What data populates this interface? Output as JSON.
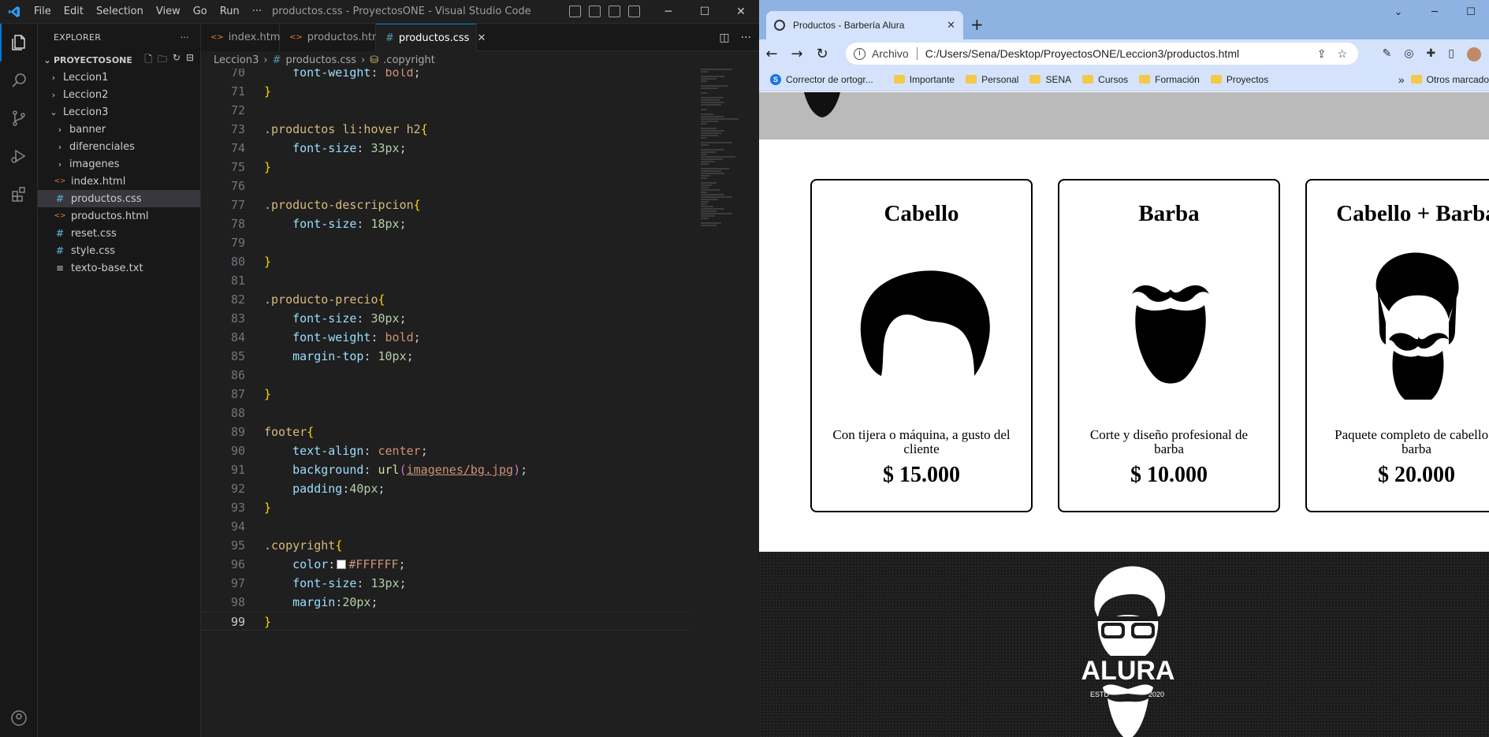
{
  "vscode": {
    "title": "productos.css - ProyectosONE - Visual Studio Code",
    "menu": [
      "File",
      "Edit",
      "Selection",
      "View",
      "Go",
      "Run",
      "···"
    ],
    "explorer": {
      "header": "EXPLORER",
      "root": "PROYECTOSONE",
      "items": [
        {
          "label": "Leccion1",
          "type": "folder",
          "expanded": false,
          "depth": 0
        },
        {
          "label": "Leccion2",
          "type": "folder",
          "expanded": false,
          "depth": 0
        },
        {
          "label": "Leccion3",
          "type": "folder",
          "expanded": true,
          "depth": 0
        },
        {
          "label": "banner",
          "type": "folder",
          "expanded": false,
          "depth": 1
        },
        {
          "label": "diferenciales",
          "type": "folder",
          "expanded": false,
          "depth": 1
        },
        {
          "label": "imagenes",
          "type": "folder",
          "expanded": false,
          "depth": 1
        },
        {
          "label": "index.html",
          "type": "html",
          "depth": 1
        },
        {
          "label": "productos.css",
          "type": "css",
          "depth": 1,
          "selected": true
        },
        {
          "label": "productos.html",
          "type": "html",
          "depth": 1
        },
        {
          "label": "reset.css",
          "type": "css",
          "depth": 1
        },
        {
          "label": "style.css",
          "type": "css",
          "depth": 1
        },
        {
          "label": "texto-base.txt",
          "type": "txt",
          "depth": 1
        }
      ]
    },
    "tabs": [
      {
        "label": "index.html",
        "type": "html",
        "active": false
      },
      {
        "label": "productos.html",
        "type": "html",
        "active": false
      },
      {
        "label": "productos.css",
        "type": "css",
        "active": true
      }
    ],
    "breadcrumb": [
      "Leccion3",
      "productos.css",
      ".copyright"
    ],
    "code": [
      {
        "n": "70",
        "t": [
          [
            "    ",
            ""
          ],
          [
            "font-weight",
            "prop"
          ],
          [
            ": ",
            ""
          ],
          [
            "bold",
            "val"
          ],
          [
            ";",
            ""
          ]
        ]
      },
      {
        "n": "71",
        "t": [
          [
            "}",
            "br"
          ]
        ]
      },
      {
        "n": "72",
        "t": []
      },
      {
        "n": "73",
        "t": [
          [
            ".productos li:hover h2",
            "sel"
          ],
          [
            "{",
            "br"
          ]
        ]
      },
      {
        "n": "74",
        "t": [
          [
            "    ",
            ""
          ],
          [
            "font-size",
            "prop"
          ],
          [
            ": ",
            ""
          ],
          [
            "33px",
            "num"
          ],
          [
            ";",
            ""
          ]
        ]
      },
      {
        "n": "75",
        "t": [
          [
            "}",
            "br"
          ]
        ]
      },
      {
        "n": "76",
        "t": []
      },
      {
        "n": "77",
        "t": [
          [
            ".producto-descripcion",
            "sel"
          ],
          [
            "{",
            "br"
          ]
        ]
      },
      {
        "n": "78",
        "t": [
          [
            "    ",
            ""
          ],
          [
            "font-size",
            "prop"
          ],
          [
            ": ",
            ""
          ],
          [
            "18px",
            "num"
          ],
          [
            ";",
            ""
          ]
        ]
      },
      {
        "n": "79",
        "t": []
      },
      {
        "n": "80",
        "t": [
          [
            "}",
            "br"
          ]
        ]
      },
      {
        "n": "81",
        "t": []
      },
      {
        "n": "82",
        "t": [
          [
            ".producto-precio",
            "sel"
          ],
          [
            "{",
            "br"
          ]
        ]
      },
      {
        "n": "83",
        "t": [
          [
            "    ",
            ""
          ],
          [
            "font-size",
            "prop"
          ],
          [
            ": ",
            ""
          ],
          [
            "30px",
            "num"
          ],
          [
            ";",
            ""
          ]
        ]
      },
      {
        "n": "84",
        "t": [
          [
            "    ",
            ""
          ],
          [
            "font-weight",
            "prop"
          ],
          [
            ": ",
            ""
          ],
          [
            "bold",
            "val"
          ],
          [
            ";",
            ""
          ]
        ]
      },
      {
        "n": "85",
        "t": [
          [
            "    ",
            ""
          ],
          [
            "margin-top",
            "prop"
          ],
          [
            ": ",
            ""
          ],
          [
            "10px",
            "num"
          ],
          [
            ";",
            ""
          ]
        ]
      },
      {
        "n": "86",
        "t": []
      },
      {
        "n": "87",
        "t": [
          [
            "}",
            "br"
          ]
        ]
      },
      {
        "n": "88",
        "t": []
      },
      {
        "n": "89",
        "t": [
          [
            "footer",
            "sel"
          ],
          [
            "{",
            "br"
          ]
        ]
      },
      {
        "n": "90",
        "t": [
          [
            "    ",
            ""
          ],
          [
            "text-align",
            "prop"
          ],
          [
            ": ",
            ""
          ],
          [
            "center",
            "val"
          ],
          [
            ";",
            ""
          ]
        ]
      },
      {
        "n": "91",
        "t": [
          [
            "    ",
            ""
          ],
          [
            "background",
            "prop"
          ],
          [
            ": ",
            ""
          ],
          [
            "url",
            "fn"
          ],
          [
            "(",
            "p2"
          ],
          [
            "imagenes/bg.jpg",
            "url"
          ],
          [
            ")",
            "p2"
          ],
          [
            ";",
            ""
          ]
        ]
      },
      {
        "n": "92",
        "t": [
          [
            "    ",
            ""
          ],
          [
            "padding",
            "prop"
          ],
          [
            ":",
            ""
          ],
          [
            "40px",
            "num"
          ],
          [
            ";",
            ""
          ]
        ]
      },
      {
        "n": "93",
        "t": [
          [
            "}",
            "br"
          ]
        ]
      },
      {
        "n": "94",
        "t": []
      },
      {
        "n": "95",
        "t": [
          [
            ".copyright",
            "sel"
          ],
          [
            "{",
            "br"
          ]
        ]
      },
      {
        "n": "96",
        "t": [
          [
            "    ",
            ""
          ],
          [
            "color",
            "prop"
          ],
          [
            ":",
            ""
          ],
          [
            "SWATCH",
            "swatch"
          ],
          [
            "#FFFFFF",
            "val"
          ],
          [
            ";",
            ""
          ]
        ]
      },
      {
        "n": "97",
        "t": [
          [
            "    ",
            ""
          ],
          [
            "font-size",
            "prop"
          ],
          [
            ": ",
            ""
          ],
          [
            "13px",
            "num"
          ],
          [
            ";",
            ""
          ]
        ]
      },
      {
        "n": "98",
        "t": [
          [
            "    ",
            ""
          ],
          [
            "margin",
            "prop"
          ],
          [
            ":",
            ""
          ],
          [
            "20px",
            "num"
          ],
          [
            ";",
            ""
          ]
        ]
      },
      {
        "n": "99",
        "t": [
          [
            "}",
            "br"
          ]
        ],
        "current": true
      }
    ]
  },
  "chrome": {
    "tab_title": "Productos - Barbería Alura",
    "address_chip": "Archivo",
    "address": "C:/Users/Sena/Desktop/ProyectosONE/Leccion3/productos.html",
    "bookmarks": [
      "Corrector de ortogr...",
      "Importante",
      "Personal",
      "SENA",
      "Cursos",
      "Formación",
      "Proyectos"
    ],
    "bookmarks_more": "»",
    "other_bookmarks": "Otros marcado",
    "products": [
      {
        "name": "Cabello",
        "icon": "hair-icon",
        "description": "Con tijera o máquina, a gusto del cliente",
        "price": "$ 15.000"
      },
      {
        "name": "Barba",
        "icon": "beard-icon",
        "description": "Corte y diseño profesional de barba",
        "price": "$ 10.000"
      },
      {
        "name": "Cabello + Barba",
        "icon": "hair-beard-icon",
        "description": "Paquete completo de cabello y barba",
        "price": "$ 20.000"
      }
    ],
    "footer_logo": {
      "brand": "ALURA",
      "left": "ESTD",
      "right": "2020"
    }
  },
  "colors": {
    "vscode_accent": "#0078d4",
    "chrome_frame": "#8eb2e2",
    "chrome_toolbar": "#d4e3fb"
  }
}
